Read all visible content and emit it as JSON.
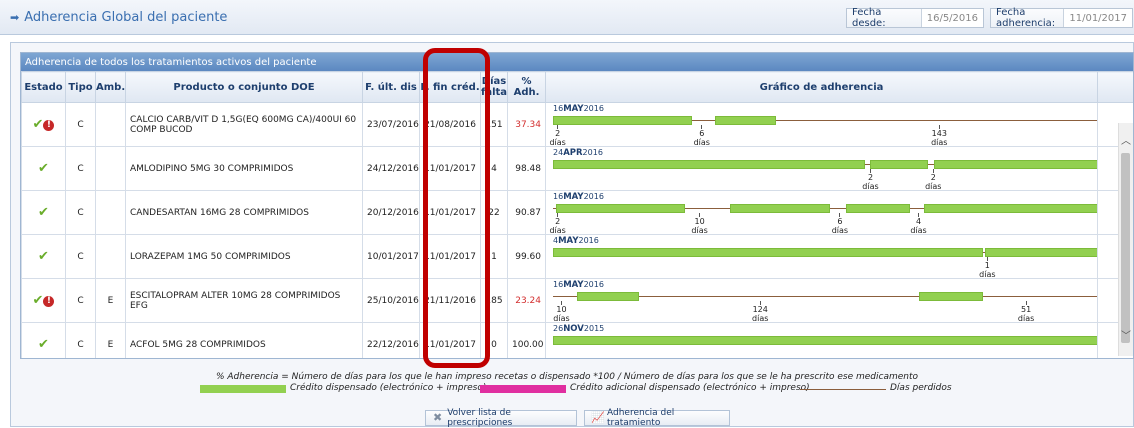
{
  "header": {
    "title": "Adherencia Global del paciente",
    "title_icon": "arrow-right-icon",
    "fecha_desde_label": "Fecha desde:",
    "fecha_desde_value": "16/5/2016",
    "fecha_adh_label": "Fecha adherencia:",
    "fecha_adh_value": "11/01/2017"
  },
  "grid": {
    "title": "Adherencia de todos los tratamientos activos del paciente",
    "columns": [
      "Estado",
      "Tipo",
      "Amb.",
      "Producto o conjunto DOE",
      "F. últ. dis",
      "F. fin créd.",
      "Días falta",
      "% Adh.",
      "Gráfico de adherencia"
    ],
    "rows": [
      {
        "tipo": "C",
        "amb": "",
        "producto": "CALCIO CARB/VIT D 1,5G(EQ 600MG CA)/400UI 60 COMP BUCOD",
        "f_ult": "23/07/2016",
        "f_fin": "21/08/2016",
        "dias": "151",
        "adh": "37.34",
        "adh_red": true,
        "alert": true,
        "chart": {
          "date_day": "16",
          "date_month": "MAY",
          "date_year": "2016",
          "bars": [
            [
              0,
              0.255
            ],
            [
              0.297,
              0.409
            ]
          ],
          "gaps": [
            {
              "pos": 0.003,
              "label": "2"
            },
            {
              "pos": 0.267,
              "label": "6"
            },
            {
              "pos": 0.702,
              "label": "143"
            }
          ]
        }
      },
      {
        "tipo": "C",
        "amb": "",
        "producto": "AMLODIPINO 5MG 30 COMPRIMIDOS",
        "f_ult": "24/12/2016",
        "f_fin": "11/01/2017",
        "dias": "4",
        "adh": "98.48",
        "adh_red": false,
        "alert": false,
        "chart": {
          "date_day": "24",
          "date_month": "APR",
          "date_year": "2016",
          "bars": [
            [
              0,
              0.571
            ],
            [
              0.581,
              0.686
            ],
            [
              0.697,
              1
            ]
          ],
          "gaps": [
            {
              "pos": 0.576,
              "label": "2"
            },
            {
              "pos": 0.691,
              "label": "2"
            }
          ]
        }
      },
      {
        "tipo": "C",
        "amb": "",
        "producto": "CANDESARTAN 16MG 28 COMPRIMIDOS",
        "f_ult": "20/12/2016",
        "f_fin": "11/01/2017",
        "dias": "22",
        "adh": "90.87",
        "adh_red": false,
        "alert": false,
        "chart": {
          "date_day": "16",
          "date_month": "MAY",
          "date_year": "2016",
          "bars": [
            [
              0.005,
              0.242
            ],
            [
              0.325,
              0.508
            ],
            [
              0.537,
              0.653
            ],
            [
              0.68,
              1
            ]
          ],
          "gaps": [
            {
              "pos": 0.003,
              "label": "2"
            },
            {
              "pos": 0.263,
              "label": "10"
            },
            {
              "pos": 0.52,
              "label": "6"
            },
            {
              "pos": 0.664,
              "label": "4"
            }
          ]
        }
      },
      {
        "tipo": "C",
        "amb": "",
        "producto": "LORAZEPAM 1MG 50 COMPRIMIDOS",
        "f_ult": "10/01/2017",
        "f_fin": "11/01/2017",
        "dias": "1",
        "adh": "99.60",
        "adh_red": false,
        "alert": false,
        "chart": {
          "date_day": "4",
          "date_month": "MAY",
          "date_year": "2016",
          "bars": [
            [
              0,
              0.787
            ],
            [
              0.792,
              1
            ]
          ],
          "gaps": [
            {
              "pos": 0.79,
              "label": "1"
            }
          ]
        }
      },
      {
        "tipo": "C",
        "amb": "E",
        "producto": "ESCITALOPRAM ALTER 10MG 28 COMPRIMIDOS EFG",
        "f_ult": "25/10/2016",
        "f_fin": "21/11/2016",
        "dias": "185",
        "adh": "23.24",
        "adh_red": true,
        "alert": true,
        "chart": {
          "date_day": "16",
          "date_month": "MAY",
          "date_year": "2016",
          "bars": [
            [
              0.044,
              0.158
            ],
            [
              0.67,
              0.788
            ]
          ],
          "gaps": [
            {
              "pos": 0.01,
              "label": "10"
            },
            {
              "pos": 0.374,
              "label": "124"
            },
            {
              "pos": 0.861,
              "label": "51"
            }
          ]
        }
      },
      {
        "tipo": "C",
        "amb": "E",
        "producto": "ACFOL 5MG 28 COMPRIMIDOS",
        "f_ult": "22/12/2016",
        "f_fin": "11/01/2017",
        "dias": "0",
        "adh": "100.00",
        "adh_red": false,
        "alert": false,
        "chart": {
          "date_day": "26",
          "date_month": "NOV",
          "date_year": "2015",
          "bars": [
            [
              0,
              1
            ]
          ],
          "gaps": []
        }
      }
    ]
  },
  "gap_unit": "días",
  "legend": {
    "formula": "% Adherencia = Número de días para los que le han impreso recetas o dispensado *100 / Número de días para los que se le ha prescrito ese medicamento",
    "credito": "Crédito dispensado (electrónico + impreso)",
    "credito_adicional": "Crédito adicional dispensado (electrónico + impreso)",
    "perdidos": "Días perdidos"
  },
  "buttons": {
    "volver": "Volver lista de prescripciones",
    "adherencia": "Adherencia del tratamiento"
  },
  "colors": {
    "credit": "#92d050",
    "extra_credit": "#e02fa0",
    "lost": "#8b5e3c",
    "alert": "#c62828",
    "highlight": "#c00000"
  }
}
